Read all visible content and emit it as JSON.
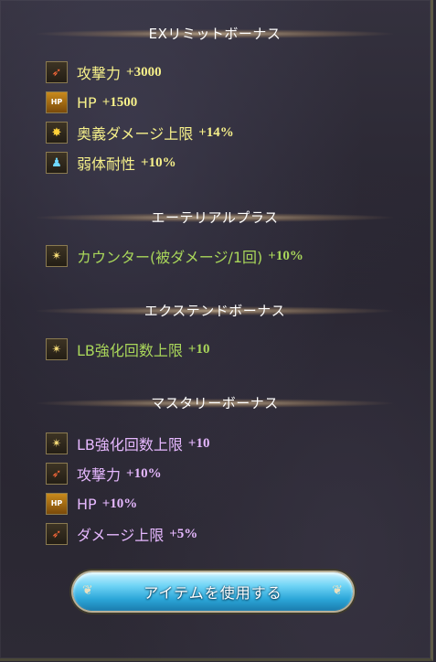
{
  "sections": {
    "ex": {
      "title": "EXリミットボーナス",
      "rows": [
        {
          "label": "攻撃力",
          "value": "+3000",
          "icon": "attack-icon"
        },
        {
          "label": "HP",
          "value": "+1500",
          "icon": "hp-icon",
          "icon_text": "HP"
        },
        {
          "label": "奥義ダメージ上限",
          "value": "+14%",
          "icon": "ougi-cap-icon"
        },
        {
          "label": "弱体耐性",
          "value": "+10%",
          "icon": "debuff-resist-icon"
        }
      ]
    },
    "ethereal": {
      "title": "エーテリアルプラス",
      "rows": [
        {
          "label": "カウンター(被ダメージ/1回)",
          "value": "+10%",
          "icon": "star-burst-icon"
        }
      ]
    },
    "extend": {
      "title": "エクステンドボーナス",
      "rows": [
        {
          "label": "LB強化回数上限",
          "value": "+10",
          "icon": "star-burst-icon"
        }
      ]
    },
    "mastery": {
      "title": "マスタリーボーナス",
      "rows": [
        {
          "label": "LB強化回数上限",
          "value": "+10",
          "icon": "star-burst-icon"
        },
        {
          "label": "攻撃力",
          "value": "+10%",
          "icon": "attack-icon"
        },
        {
          "label": "HP",
          "value": "+10%",
          "icon": "hp-icon",
          "icon_text": "HP"
        },
        {
          "label": "ダメージ上限",
          "value": "+5%",
          "icon": "damage-cap-icon"
        }
      ]
    }
  },
  "button": {
    "label": "アイテムを使用する"
  },
  "colors": {
    "ex": "#f6f08a",
    "ethereal": "#a9d65a",
    "extend": "#a9d65a",
    "mastery": "#e6b8ff"
  }
}
